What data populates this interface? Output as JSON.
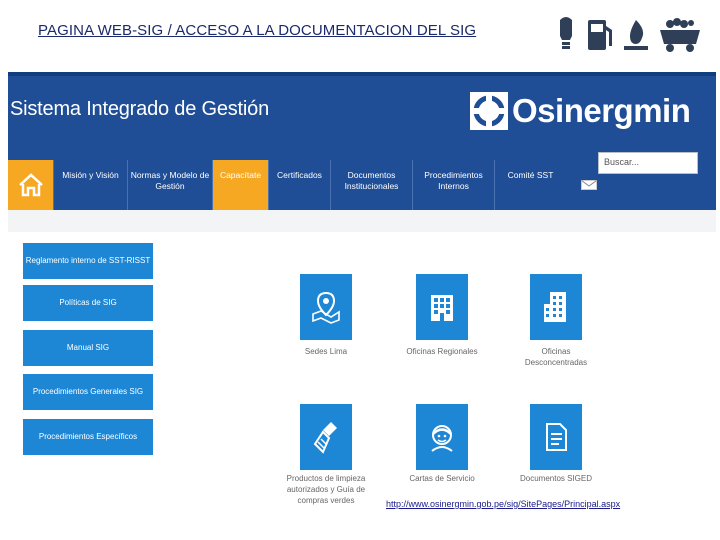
{
  "slide": {
    "title": "PAGINA WEB-SIG / ACCESO  A LA DOCUMENTACION DEL SIG",
    "icons": [
      "bulb-icon",
      "fuel-pump-icon",
      "gas-flame-icon",
      "mining-cart-icon"
    ]
  },
  "site": {
    "title": "Sistema Integrado de Gestión",
    "brand": "Osinergmin",
    "colors": {
      "header": "#1f4e96",
      "accent": "#f7a823",
      "tile": "#1d87d6"
    }
  },
  "nav": {
    "items": [
      {
        "label": "Misión y Visión"
      },
      {
        "label": "Normas y Modelo de Gestión"
      },
      {
        "label": "Capacítate"
      },
      {
        "label": "Certificados"
      },
      {
        "label": "Documentos Institucionales"
      },
      {
        "label": "Procedimientos Internos"
      },
      {
        "label": "Comité SST"
      }
    ]
  },
  "search": {
    "placeholder": "Buscar..."
  },
  "sidebar": {
    "buttons": [
      {
        "label": "Reglamento interno de SST-RISST"
      },
      {
        "label": "Políticas de SIG"
      },
      {
        "label": "Manual SIG"
      },
      {
        "label": "Procedimientos Generales SIG"
      },
      {
        "label": "Procedimientos Específicos"
      }
    ]
  },
  "tiles": [
    {
      "label": "Sedes Lima",
      "icon": "map-pin-icon"
    },
    {
      "label": "Oficinas Regionales",
      "icon": "building-icon"
    },
    {
      "label": "Oficinas Desconcentradas",
      "icon": "office-tower-icon"
    },
    {
      "label": "Productos de limpieza autorizados y Guía de compras verdes",
      "icon": "cleaning-brush-icon"
    },
    {
      "label": "Cartas de Servicio",
      "icon": "service-agent-icon"
    },
    {
      "label": "Documentos SIGED",
      "icon": "document-icon"
    }
  ],
  "footer": {
    "url": "http://www.osinergmin.gob.pe/sig/SitePages/Principal.aspx"
  }
}
